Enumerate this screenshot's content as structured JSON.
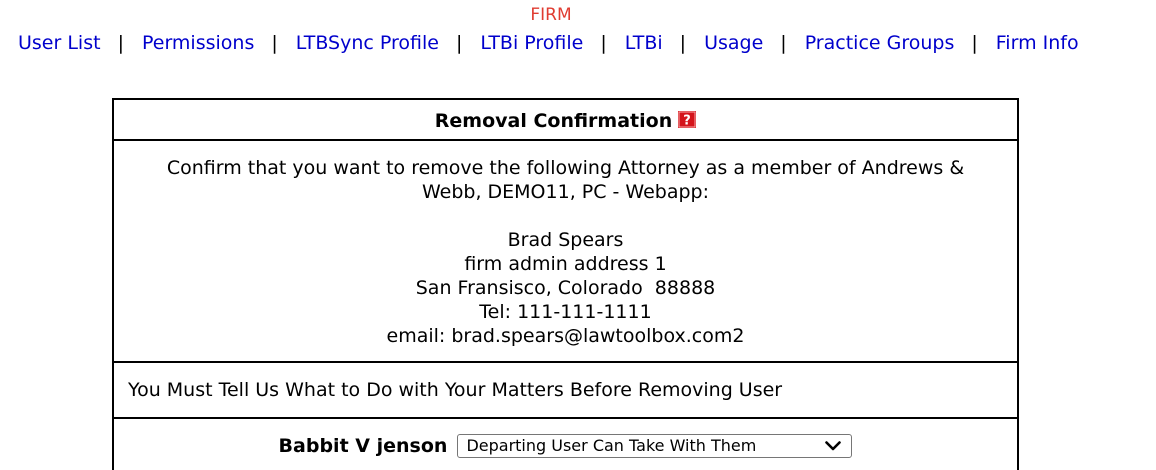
{
  "colors": {
    "link": "#0000cc",
    "section_title": "#e03c31",
    "border": "#000000",
    "help_icon_bg": "#d4141b"
  },
  "header": {
    "section_title": "FIRM"
  },
  "nav": {
    "items": [
      {
        "label": "User List"
      },
      {
        "label": "Permissions"
      },
      {
        "label": "LTBSync Profile"
      },
      {
        "label": "LTBi Profile"
      },
      {
        "label": "LTBi"
      },
      {
        "label": "Usage"
      },
      {
        "label": "Practice Groups"
      },
      {
        "label": "Firm Info"
      }
    ],
    "separator": "|"
  },
  "dialog": {
    "title": "Removal Confirmation",
    "help_icon": "question-icon",
    "message": "Confirm that you want to remove the following Attorney as a member of Andrews & Webb, DEMO11, PC - Webapp:",
    "user": {
      "name": "Brad Spears",
      "address": "firm admin address 1",
      "city_line": "San Fransisco, Colorado  88888",
      "tel": "Tel: 111-111-1111",
      "email": "email: brad.spears@lawtoolbox.com2"
    },
    "warning": "You Must Tell Us What to Do with Your Matters Before Removing User",
    "matter": {
      "name": "Babbit V jenson",
      "selected_action": "Departing User Can Take With Them"
    }
  }
}
